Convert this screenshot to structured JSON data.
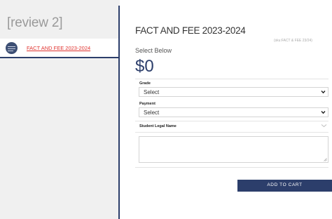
{
  "sidebar": {
    "title": "[review 2]",
    "items": [
      {
        "label": "FACT AND FEE 2023-2024",
        "icon": "product-thumbnail-icon"
      }
    ]
  },
  "product": {
    "title": "FACT AND FEE 2023-2024",
    "sku": "(sku:FACT & FEE 23/24)",
    "instruction": "Select Below",
    "price": "$0"
  },
  "form": {
    "grade": {
      "label": "Grade",
      "value": "Select"
    },
    "payment": {
      "label": "Payment",
      "value": "Select"
    },
    "legal_name": {
      "label": "Student Legal Name",
      "value": ""
    }
  },
  "cart": {
    "button_label": "ADD TO CART"
  },
  "colors": {
    "accent": "#2c3e6b",
    "link": "#e0322e",
    "sidebar_bg": "#f0f0f0"
  }
}
